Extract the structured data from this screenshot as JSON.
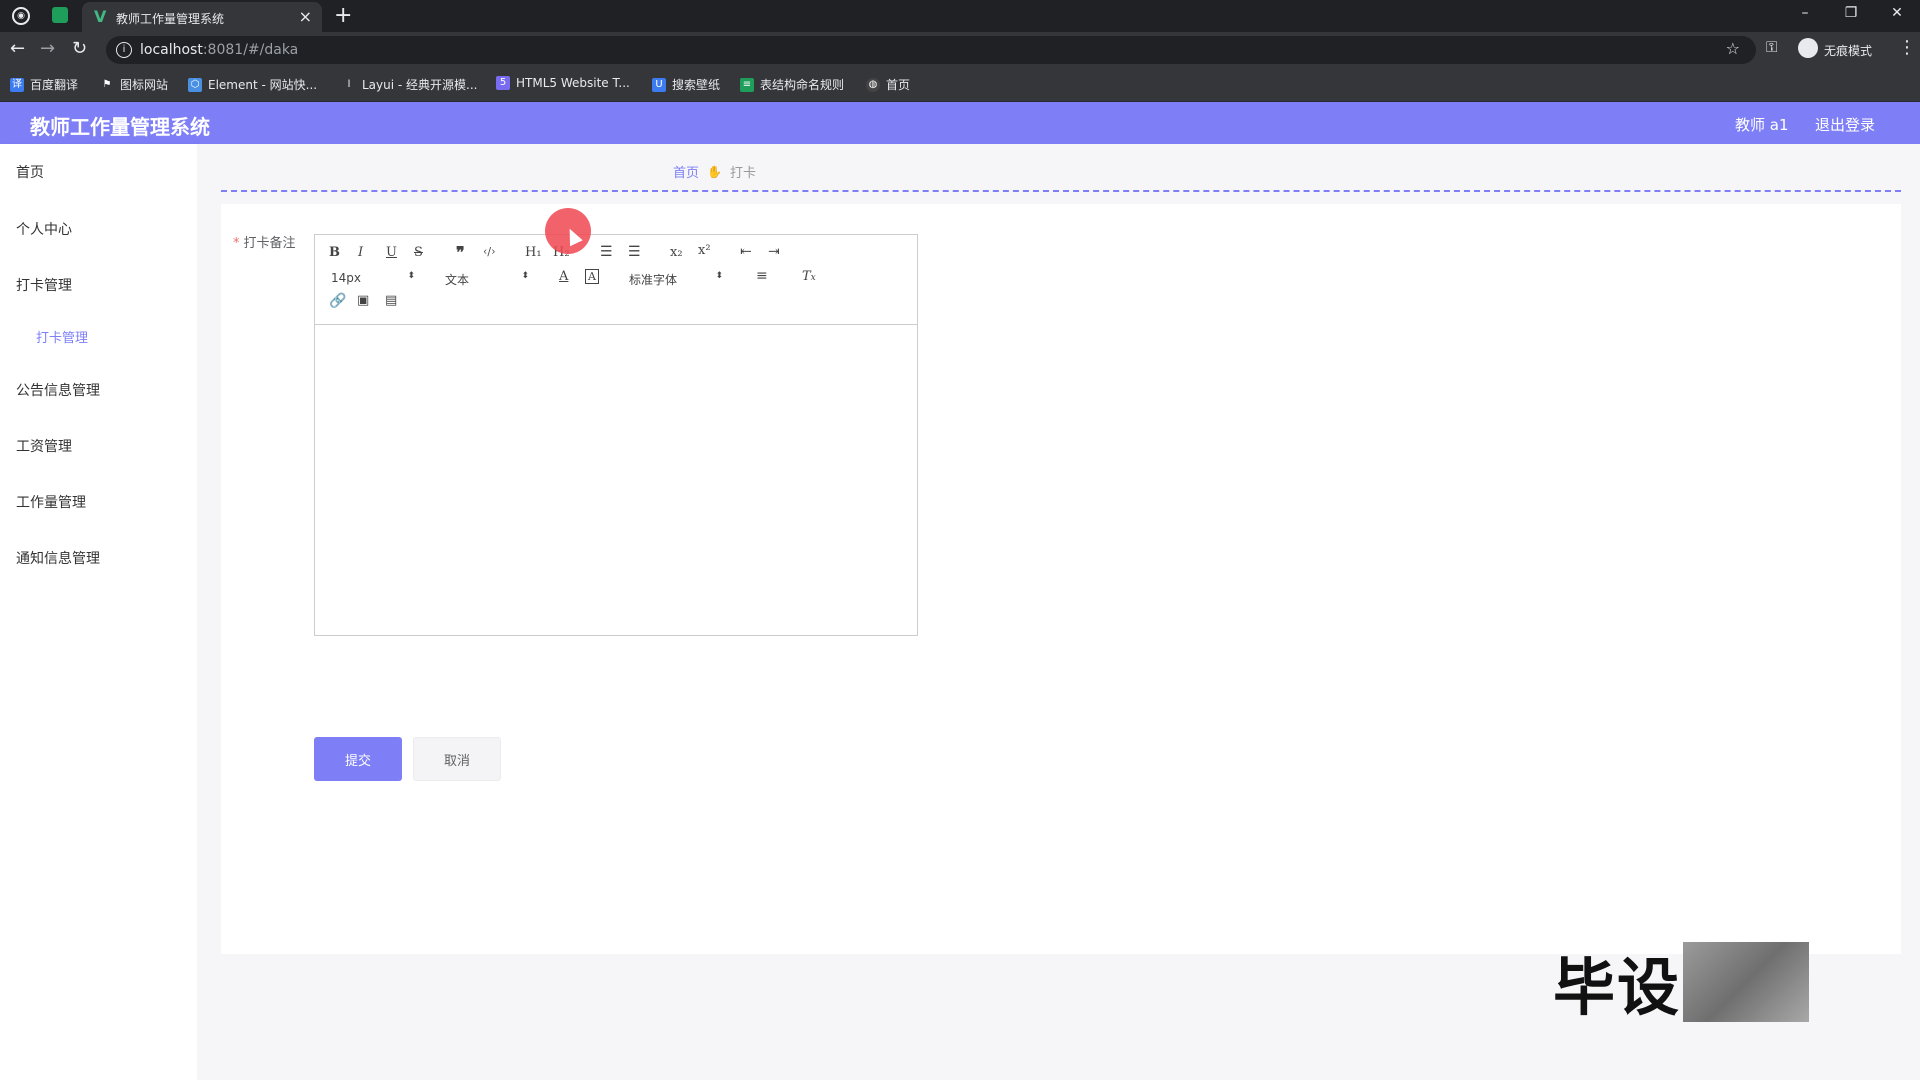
{
  "browser": {
    "tab_title": "教师工作量管理系统",
    "url_host": "localhost",
    "url_path": ":8081/#/daka",
    "profile_label": "无痕模式",
    "bookmarks": [
      {
        "label": "百度翻译",
        "color": "#3d7bf0"
      },
      {
        "label": "图标网站",
        "color": "#111111"
      },
      {
        "label": "Element - 网站快...",
        "color": "#4a90e2"
      },
      {
        "label": "Layui - 经典开源模...",
        "color": "#333333"
      },
      {
        "label": "HTML5 Website T...",
        "color": "#7a6cf0"
      },
      {
        "label": "搜索壁纸",
        "color": "#3d7bf0"
      },
      {
        "label": "表结构命名规则",
        "color": "#1e9e5a"
      },
      {
        "label": "首页",
        "color": "#444444"
      }
    ]
  },
  "header": {
    "title": "教师工作量管理系统",
    "user": "教师 a1",
    "logout": "退出登录"
  },
  "sidebar": {
    "items": [
      "首页",
      "个人中心",
      "打卡管理",
      "公告信息管理",
      "工资管理",
      "工作量管理",
      "通知信息管理"
    ],
    "sub_item": "打卡管理"
  },
  "breadcrumb": {
    "home": "首页",
    "current": "打卡"
  },
  "form": {
    "label": "打卡备注",
    "submit": "提交",
    "cancel": "取消"
  },
  "editor": {
    "size_select": "14px",
    "header_select": "文本",
    "font_select": "标准字体"
  },
  "watermark": {
    "text": "毕设"
  },
  "colors": {
    "accent": "#7e7ff6",
    "required": "#f56c6c",
    "breadcrumb_sep": "#e6a23c"
  }
}
